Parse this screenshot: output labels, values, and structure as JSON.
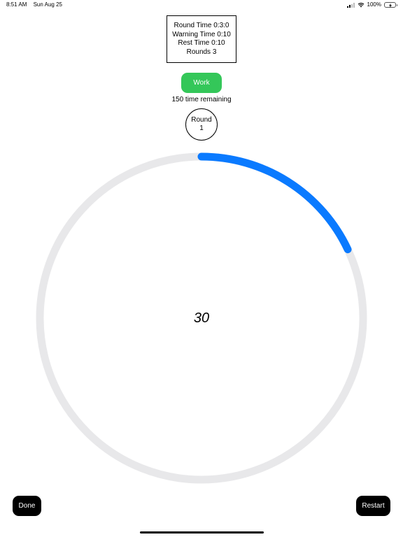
{
  "status_bar": {
    "time": "8:51 AM",
    "date": "Sun Aug 25",
    "battery": "100%"
  },
  "settings": {
    "round_time": "Round Time  0:3:0",
    "warning_time": "Warning Time  0:10",
    "rest_time": "Rest Time  0:10",
    "rounds": "Rounds  3"
  },
  "phase": {
    "label": "Work",
    "color": "#34c759"
  },
  "time_remaining": "150 time remaining",
  "round": {
    "label": "Round",
    "number": "1"
  },
  "timer": {
    "countdown": "30",
    "progress_fraction": 0.18,
    "progress_color": "#0a7aff",
    "track_color": "#e8e8ea"
  },
  "buttons": {
    "done": "Done",
    "restart": "Restart"
  },
  "icons": {
    "signal": "cellular-signal-icon",
    "wifi": "wifi-icon",
    "battery": "battery-charging-icon"
  }
}
